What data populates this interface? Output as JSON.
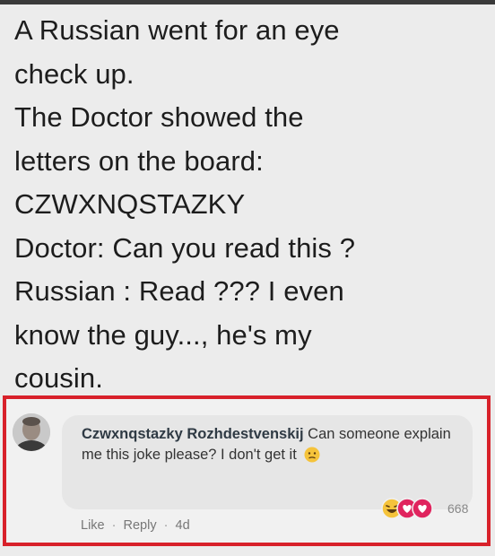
{
  "post": {
    "lines": [
      "A Russian went for an eye",
      "check up.",
      "The Doctor showed the",
      "letters on the board:",
      "CZWXNQSTAZKY",
      "Doctor: Can you read this ?",
      "Russian : Read ??? I even",
      "know the guy..., he's my",
      "cousin."
    ]
  },
  "comment": {
    "author": "Czwxnqstazky Rozhdestvenskij",
    "text": "Can someone explain me this joke please? I don't get it",
    "inline_emoji": "confused-face",
    "actions": {
      "like_label": "Like",
      "reply_label": "Reply",
      "separator": "·",
      "time": "4d"
    },
    "reactions": {
      "icons": [
        "laughing-face",
        "heart",
        "heart"
      ],
      "count": "668"
    }
  },
  "colors": {
    "highlight_border": "#d8212a",
    "reaction_heart": "#e0245e",
    "reaction_face": "#f5c33b"
  }
}
